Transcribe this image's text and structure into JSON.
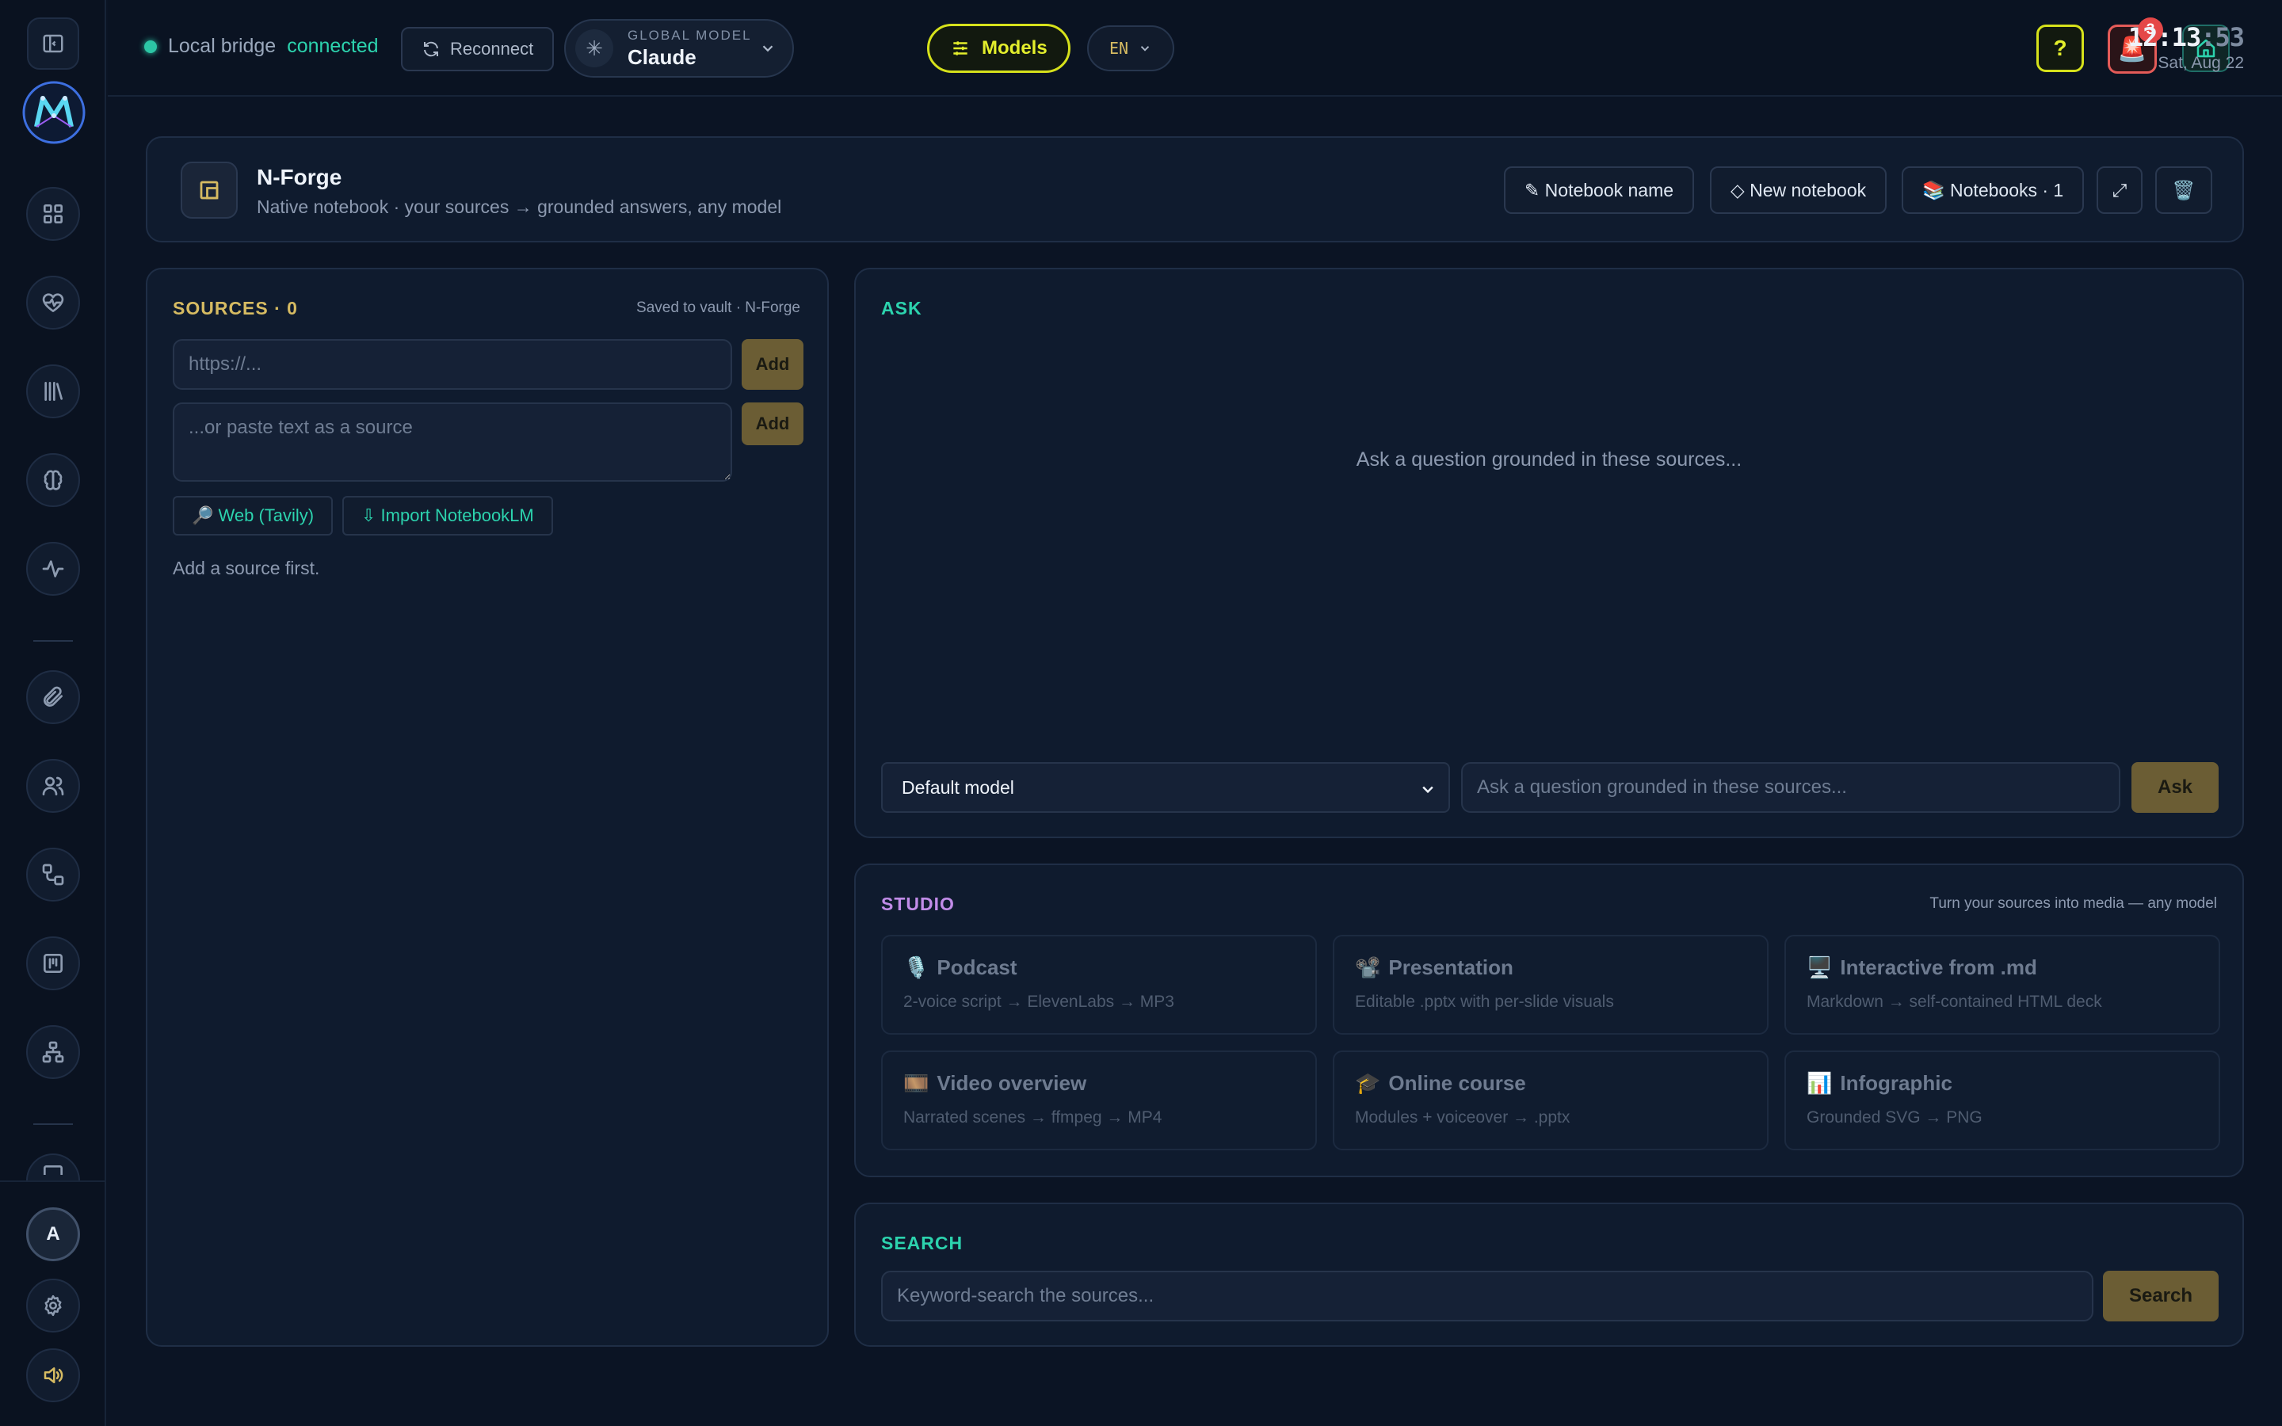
{
  "topbar": {
    "status_prefix": "Local bridge",
    "status_value": "connected",
    "reconnect_label": "Reconnect",
    "model_label": "GLOBAL MODEL",
    "model_value": "Claude",
    "models_label": "Models",
    "lang": "EN",
    "help_label": "?",
    "alert_count": "3",
    "clock_hm": "12:13",
    "clock_sec": ":53",
    "date": "Sat, Aug 22"
  },
  "sidebar": {
    "avatar_initial": "A",
    "items": [
      "dashboard-icon",
      "heart-pulse-icon",
      "library-icon",
      "brain-icon",
      "activity-icon",
      "paperclip-icon",
      "users-icon",
      "workflow-icon",
      "kanban-icon",
      "org-chart-icon"
    ]
  },
  "notebook": {
    "title": "N-Forge",
    "subtitle": "Native notebook · your sources → grounded answers, any model",
    "btn_name": "✎ Notebook name",
    "btn_new": "◇ New notebook",
    "btn_list": "📚 Notebooks · 1",
    "btn_expand": "⤢",
    "btn_delete": "🗑️"
  },
  "sources": {
    "title": "SOURCES · 0",
    "note": "Saved to vault · N-Forge",
    "url_placeholder": "https://...",
    "text_placeholder": "...or paste text as a source",
    "add_label": "Add",
    "web_label": "🔎 Web (Tavily)",
    "import_label": "⇩ Import NotebookLM",
    "empty": "Add a source first."
  },
  "ask": {
    "title": "ASK",
    "empty": "Ask a question grounded in these sources...",
    "model_select": "Default model",
    "input_placeholder": "Ask a question grounded in these sources...",
    "ask_label": "Ask"
  },
  "studio": {
    "title": "STUDIO",
    "note": "Turn your sources into media — any model",
    "cards": [
      {
        "icon": "🎙️",
        "title": "Podcast",
        "sub": "2-voice script → ElevenLabs → MP3"
      },
      {
        "icon": "📽️",
        "title": "Presentation",
        "sub": "Editable .pptx with per-slide visuals"
      },
      {
        "icon": "🖥️",
        "title": "Interactive from .md",
        "sub": "Markdown → self-contained HTML deck"
      },
      {
        "icon": "🎞️",
        "title": "Video overview",
        "sub": "Narrated scenes → ffmpeg → MP4"
      },
      {
        "icon": "🎓",
        "title": "Online course",
        "sub": "Modules + voiceover → .pptx"
      },
      {
        "icon": "📊",
        "title": "Infographic",
        "sub": "Grounded SVG → PNG"
      }
    ]
  },
  "search": {
    "title": "SEARCH",
    "placeholder": "Keyword-search the sources...",
    "button": "Search"
  },
  "colors": {
    "accent_teal": "#2cd3ae",
    "accent_gold": "#d6bb62",
    "accent_yellow": "#e3ee2c",
    "studio_purple": "#c18ce8",
    "alert_red": "#e54848"
  }
}
